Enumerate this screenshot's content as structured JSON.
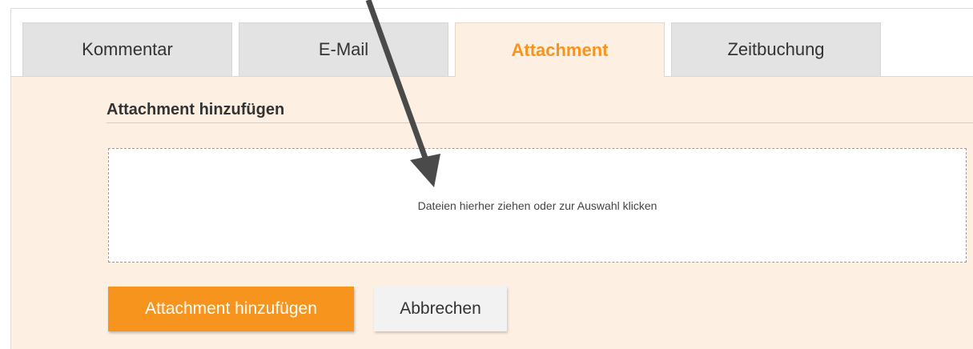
{
  "tabs": [
    {
      "label": "Kommentar",
      "active": false
    },
    {
      "label": "E-Mail",
      "active": false
    },
    {
      "label": "Attachment",
      "active": true
    },
    {
      "label": "Zeitbuchung",
      "active": false
    }
  ],
  "section": {
    "title": "Attachment hinzufügen"
  },
  "dropzone": {
    "text": "Dateien hierher ziehen oder zur Auswahl klicken"
  },
  "buttons": {
    "add_label": "Attachment hinzufügen",
    "cancel_label": "Abbrechen"
  },
  "colors": {
    "accent": "#f7941d",
    "panel_background": "#fdf0e3",
    "arrow": "#4a4a4a"
  },
  "icons": {
    "annotation": "arrow-annotation-icon"
  }
}
